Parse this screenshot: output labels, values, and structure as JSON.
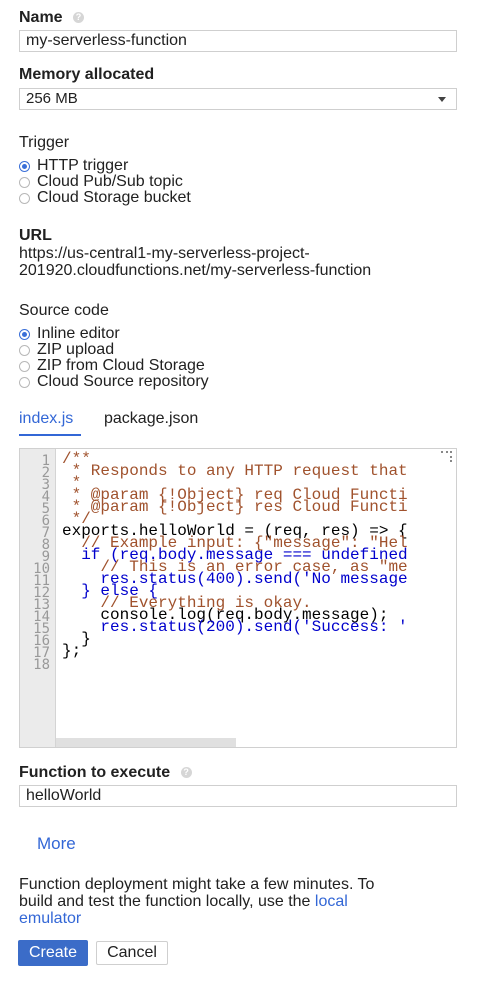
{
  "name_field": {
    "label": "Name",
    "help_icon": "question-circle-icon",
    "value": "my-serverless-function"
  },
  "memory": {
    "label": "Memory allocated",
    "value": "256 MB"
  },
  "trigger": {
    "label": "Trigger",
    "options": [
      "HTTP trigger",
      "Cloud Pub/Sub topic",
      "Cloud Storage bucket"
    ],
    "selected": "HTTP trigger"
  },
  "url": {
    "label": "URL",
    "line1": "https://us-central1-my-serverless-project-",
    "line2": "201920.cloudfunctions.net/my-serverless-function"
  },
  "source": {
    "label": "Source code",
    "options": [
      "Inline editor",
      "ZIP upload",
      "ZIP from Cloud Storage",
      "Cloud Source repository"
    ],
    "selected": "Inline editor"
  },
  "tabs": [
    {
      "label": "index.js",
      "active": true
    },
    {
      "label": "package.json",
      "active": false
    }
  ],
  "editor": {
    "line_numbers": [
      "1",
      "2",
      "3",
      "4",
      "5",
      "6",
      "7",
      "8",
      "9",
      "10",
      "11",
      "12",
      "13",
      "14",
      "15",
      "16",
      "17",
      "18"
    ],
    "lines": [
      "/**",
      " * Responds to any HTTP request that",
      " *",
      " * @param {!Object} req Cloud Functi",
      " * @param {!Object} res Cloud Functi",
      " */",
      "exports.helloWorld = (req, res) => {",
      "  // Example input: {\"message\": \"Hel",
      "  if (req.body.message === undefined",
      "    // This is an error case, as \"me",
      "    res.status(400).send('No message",
      "  } else {",
      "    // Everything is okay.",
      "    console.log(req.body.message);",
      "    res.status(200).send('Success: '",
      "  }",
      "};",
      ""
    ]
  },
  "function_to_execute": {
    "label": "Function to execute",
    "help_icon": "question-circle-icon",
    "value": "helloWorld"
  },
  "more_link": "More",
  "footer_note": {
    "line1": "Function deployment might take a few minutes. To",
    "line2_prefix": "build and test the function locally, use the ",
    "line2_link": "local",
    "line3_link": "emulator"
  },
  "buttons": {
    "create": "Create",
    "cancel": "Cancel"
  },
  "colors": {
    "accent": "#3367d6",
    "primary_button": "#3b6cc8"
  }
}
